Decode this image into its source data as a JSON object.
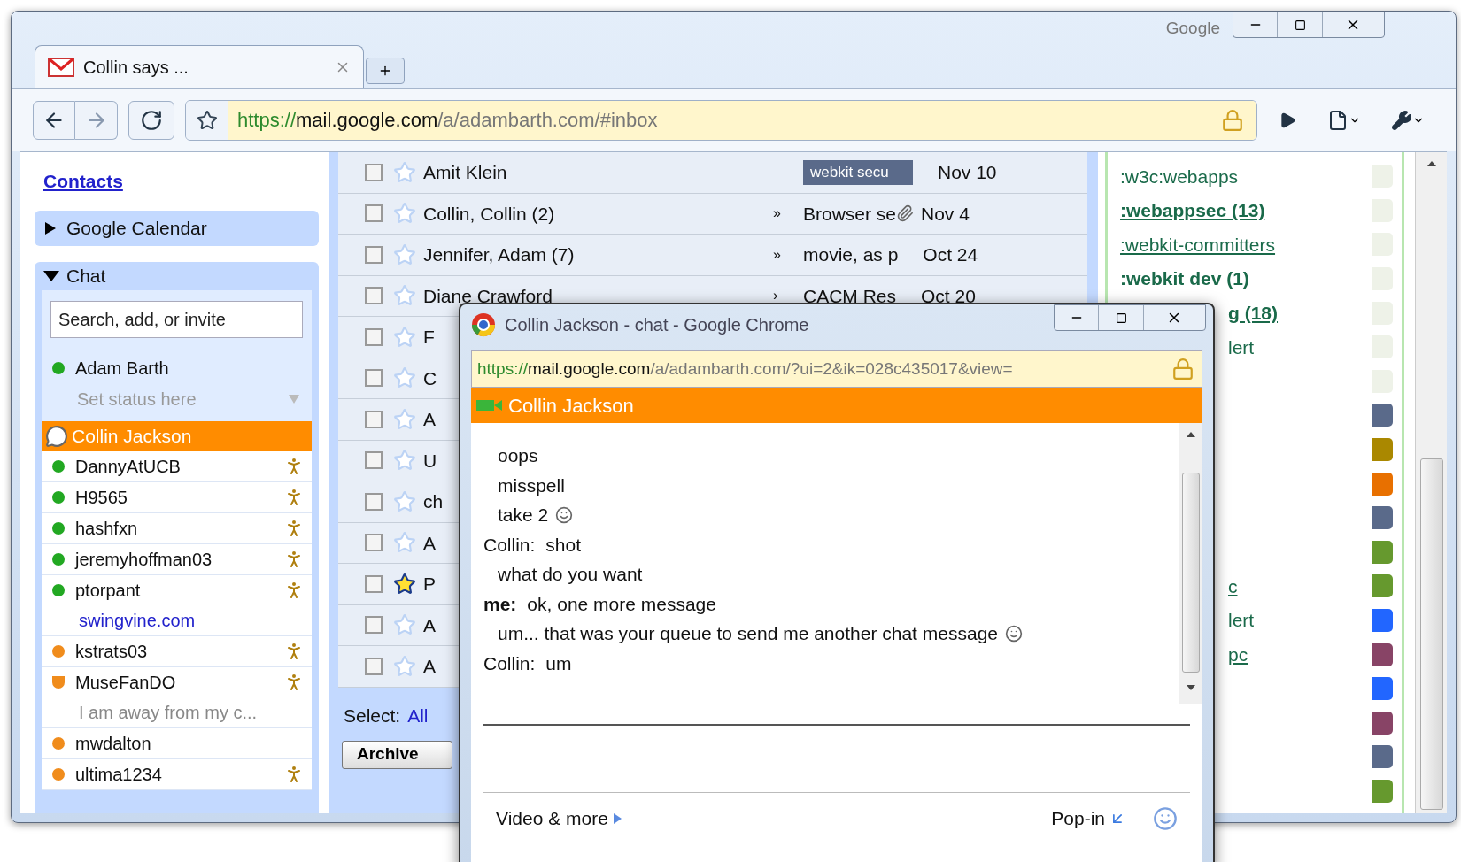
{
  "browser": {
    "brand": "Google",
    "tab": {
      "title": "Collin says ...",
      "selected": true
    },
    "url": {
      "scheme": "https://",
      "host": "mail.google.com",
      "path": "/a/adambarth.com/#inbox"
    }
  },
  "sidebar": {
    "contacts_link": "Contacts",
    "calendar": {
      "title": "Google Calendar",
      "expanded": false
    },
    "chat": {
      "title": "Chat",
      "expanded": true,
      "search_placeholder": "Search, add, or invite",
      "me": {
        "name": "Adam Barth",
        "status_text": "Set status here"
      },
      "contacts": [
        {
          "name": "Collin Jackson",
          "kind": "chatting",
          "selected": true,
          "video": false
        },
        {
          "name": "DannyAtUCB",
          "kind": "available",
          "selected": false,
          "video": true
        },
        {
          "name": "H9565",
          "kind": "available",
          "selected": false,
          "video": true
        },
        {
          "name": "hashfxn",
          "kind": "available",
          "selected": false,
          "video": true
        },
        {
          "name": "jeremyhoffman03",
          "kind": "available",
          "selected": false,
          "video": true
        },
        {
          "name": "ptorpant",
          "kind": "available",
          "selected": false,
          "video": true,
          "message": "swingvine.com",
          "message_is_link": true
        },
        {
          "name": "kstrats03",
          "kind": "idle",
          "selected": false,
          "video": true
        },
        {
          "name": "MuseFanDO",
          "kind": "away",
          "selected": false,
          "video": true,
          "message": "I am away from my c...",
          "message_is_link": false
        },
        {
          "name": "mwdalton",
          "kind": "idle",
          "selected": false,
          "video": false
        },
        {
          "name": "ultima1234",
          "kind": "idle",
          "selected": false,
          "video": true
        }
      ]
    }
  },
  "emails": [
    {
      "sender": "Amit Klein",
      "checked": false,
      "starred": false,
      "tag": "webkit secu",
      "date": "Nov 10"
    },
    {
      "sender": "Collin, Collin (2)",
      "checked": false,
      "starred": false,
      "thread": "»",
      "subject": "Browser se",
      "attachment": true,
      "date": "Nov 4"
    },
    {
      "sender": "Jennifer, Adam (7)",
      "checked": false,
      "starred": false,
      "thread": "»",
      "subject": "movie, as p",
      "date": "Oct 24"
    },
    {
      "sender": "Diane Crawford",
      "checked": false,
      "starred": false,
      "thread": "›",
      "subject": "CACM Res",
      "date": "Oct 20"
    },
    {
      "sender": "F",
      "checked": false,
      "starred": false
    },
    {
      "sender": "C",
      "checked": false,
      "starred": false
    },
    {
      "sender": "A",
      "checked": false,
      "starred": false
    },
    {
      "sender": "U",
      "checked": false,
      "starred": false
    },
    {
      "sender": "ch",
      "checked": false,
      "starred": false
    },
    {
      "sender": "A",
      "checked": false,
      "starred": false
    },
    {
      "sender": "P",
      "checked": false,
      "starred": true
    },
    {
      "sender": "A",
      "checked": false,
      "starred": false
    },
    {
      "sender": "A",
      "checked": false,
      "starred": false
    }
  ],
  "select": {
    "label": "Select:",
    "option": "All"
  },
  "archive_button": "Archive",
  "labels": [
    {
      "text": ":w3c:webapps",
      "bold": false,
      "underlined": false,
      "color": "#eef2e8"
    },
    {
      "text": ":webappsec (13)",
      "bold": true,
      "underlined": true,
      "color": "#eef2e8"
    },
    {
      "text": ":webkit-committers",
      "bold": false,
      "underlined": true,
      "color": "#eef2e8"
    },
    {
      "text": ":webkit dev (1)",
      "bold": true,
      "underlined": false,
      "color": "#eef2e8"
    },
    {
      "text": "g (18)",
      "bold": true,
      "underlined": true,
      "partly_hidden": true,
      "color": "#eef2e8"
    },
    {
      "text": "lert",
      "bold": false,
      "underlined": false,
      "partly_hidden": true,
      "color": "#eef2e8"
    },
    {
      "color": "#eef2e8"
    },
    {
      "color": "#5a6a8a"
    },
    {
      "color": "#aa8800"
    },
    {
      "color": "#e87000"
    },
    {
      "color": "#5a6a8a"
    },
    {
      "color": "#66992e"
    },
    {
      "text": "c",
      "bold": false,
      "underlined": true,
      "partly_hidden": true,
      "color": "#66992e"
    },
    {
      "text": "lert",
      "bold": false,
      "underlined": false,
      "partly_hidden": true,
      "color": "#2266ff"
    },
    {
      "text": "pc",
      "bold": false,
      "underlined": true,
      "partly_hidden": true,
      "color": "#884466"
    },
    {
      "color": "#2266ff"
    },
    {
      "color": "#884466"
    },
    {
      "color": "#5a6a8a"
    },
    {
      "color": "#66992e"
    }
  ],
  "popup": {
    "title": "Collin Jackson - chat - Google Chrome",
    "url": {
      "scheme": "https://",
      "host": "mail.google.com",
      "path": "/a/adambarth.com/?ui=2&ik=028c435017&view="
    },
    "contact": "Collin Jackson",
    "messages": [
      {
        "kind": "cont",
        "text": "oops",
        "emoticon": false
      },
      {
        "kind": "cont",
        "text": "misspell",
        "emoticon": false
      },
      {
        "kind": "cont",
        "text": "take 2",
        "emoticon": true
      },
      {
        "kind": "them",
        "speaker": "Collin:",
        "text": "shot",
        "emoticon": false
      },
      {
        "kind": "cont",
        "text": "what do you want",
        "emoticon": false
      },
      {
        "kind": "me",
        "speaker": "me:",
        "text": "ok, one more message",
        "emoticon": false
      },
      {
        "kind": "cont",
        "text": "um... that was your queue to send me another chat message",
        "emoticon": true
      },
      {
        "kind": "them",
        "speaker": "Collin:",
        "text": "um",
        "emoticon": false
      }
    ],
    "video_link": "Video & more",
    "popin_link": "Pop-in"
  }
}
